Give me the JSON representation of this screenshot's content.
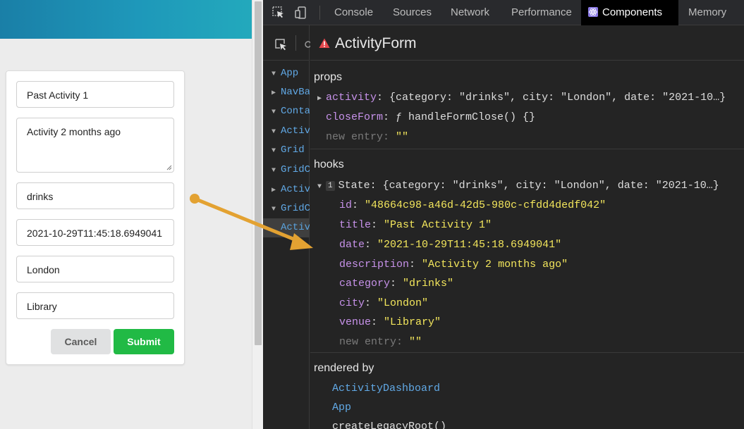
{
  "form": {
    "title": "Past Activity 1",
    "description": "Activity 2 months ago",
    "category": "drinks",
    "date": "2021-10-29T11:45:18.6949041",
    "city": "London",
    "venue": "Library",
    "cancel_label": "Cancel",
    "submit_label": "Submit"
  },
  "devtools": {
    "tabs": [
      "Console",
      "Sources",
      "Network",
      "Performance",
      "Components",
      "Memory"
    ],
    "active_tab": "Components",
    "tree": [
      "App",
      "NavBar",
      "Contai",
      "Activi",
      "Grid",
      "GridC",
      "Activi",
      "GridC",
      "Activi"
    ],
    "component_name": "ActivityForm",
    "props_title": "props",
    "props": {
      "activity_key": "activity",
      "activity_value": "{category: \"drinks\", city: \"London\", date: \"2021-10…}",
      "closeform_key": "closeForm",
      "closeform_value": "ƒ handleFormClose() {}",
      "new_entry_key": "new entry",
      "new_entry_value": "\"\""
    },
    "hooks_title": "hooks",
    "hooks": {
      "hook_index": "1",
      "state_label": "State",
      "state_summary": "{category: \"drinks\", city: \"London\", date: \"2021-10…}",
      "fields": [
        {
          "key": "id",
          "value": "\"48664c98-a46d-42d5-980c-cfdd4dedf042\""
        },
        {
          "key": "title",
          "value": "\"Past Activity 1\""
        },
        {
          "key": "date",
          "value": "\"2021-10-29T11:45:18.6949041\""
        },
        {
          "key": "description",
          "value": "\"Activity 2 months ago\""
        },
        {
          "key": "category",
          "value": "\"drinks\""
        },
        {
          "key": "city",
          "value": "\"London\""
        },
        {
          "key": "venue",
          "value": "\"Library\""
        }
      ],
      "new_entry_key": "new entry",
      "new_entry_value": "\"\""
    },
    "rendered_by_title": "rendered by",
    "rendered_by": [
      "ActivityDashboard",
      "App",
      "createLegacyRoot()"
    ]
  },
  "colors": {
    "header_gradient": [
      "#1a7fa7",
      "#23a9bc"
    ],
    "submit_green": "#21ba45",
    "arrow": "#e3a232",
    "prop_key": "#c792ea",
    "string_value": "#f3e65c",
    "component_link": "#61a9e6"
  }
}
